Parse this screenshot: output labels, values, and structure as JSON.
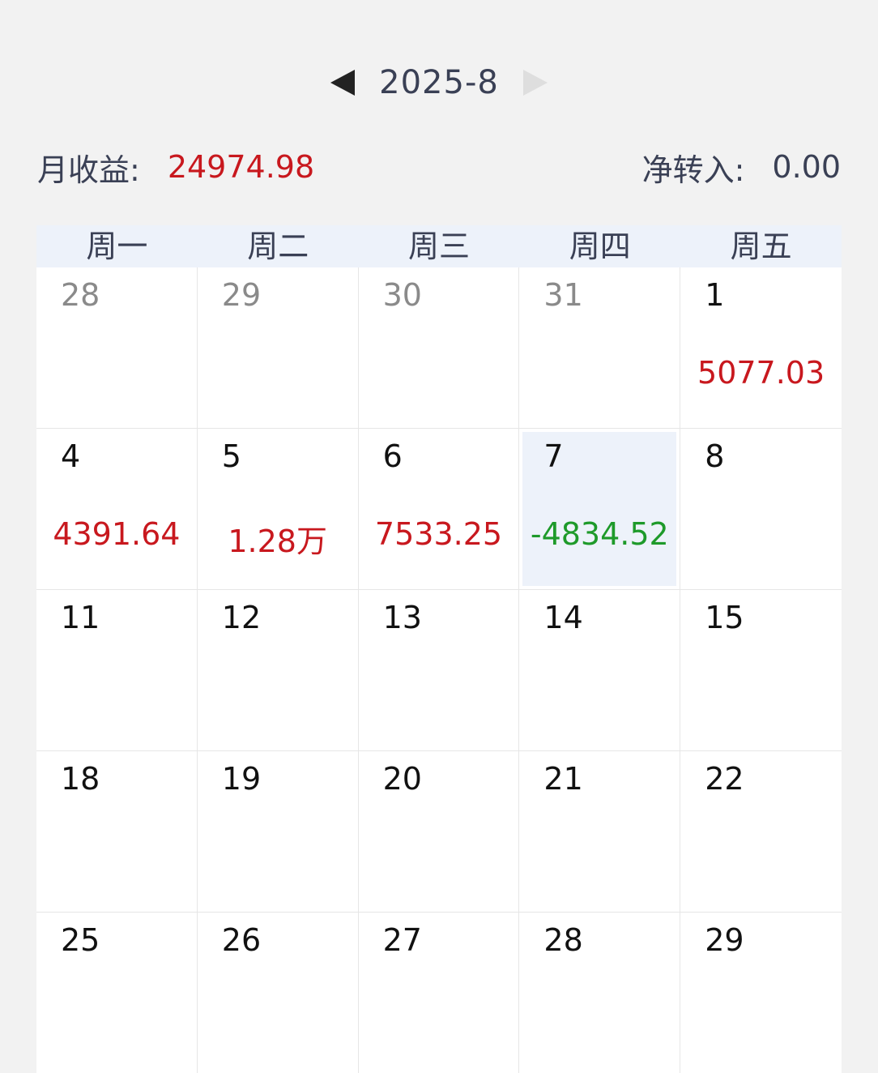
{
  "header": {
    "month_label": "2025-8",
    "prev_icon": "triangle-left-icon",
    "next_icon": "triangle-right-icon"
  },
  "summary": {
    "monthly_income_label": "月收益:",
    "monthly_income_value": "24974.98",
    "net_transfer_label": "净转入:",
    "net_transfer_value": "0.00"
  },
  "colors": {
    "positive": "#c8181e",
    "negative": "#1e9a2a",
    "header_bg": "#edf2fa"
  },
  "calendar": {
    "weekdays": [
      "周一",
      "周二",
      "周三",
      "周四",
      "周五"
    ],
    "weeks": [
      [
        {
          "day": "28",
          "amount": "",
          "other": true
        },
        {
          "day": "29",
          "amount": "",
          "other": true
        },
        {
          "day": "30",
          "amount": "",
          "other": true
        },
        {
          "day": "31",
          "amount": "",
          "other": true
        },
        {
          "day": "1",
          "amount": "5077.03",
          "sign": "pos"
        }
      ],
      [
        {
          "day": "4",
          "amount": "4391.64",
          "sign": "pos"
        },
        {
          "day": "5",
          "amount": "1.28万",
          "sign": "pos"
        },
        {
          "day": "6",
          "amount": "7533.25",
          "sign": "pos"
        },
        {
          "day": "7",
          "amount": "-4834.52",
          "sign": "neg",
          "selected": true
        },
        {
          "day": "8",
          "amount": ""
        }
      ],
      [
        {
          "day": "11",
          "amount": ""
        },
        {
          "day": "12",
          "amount": ""
        },
        {
          "day": "13",
          "amount": ""
        },
        {
          "day": "14",
          "amount": ""
        },
        {
          "day": "15",
          "amount": ""
        }
      ],
      [
        {
          "day": "18",
          "amount": ""
        },
        {
          "day": "19",
          "amount": ""
        },
        {
          "day": "20",
          "amount": ""
        },
        {
          "day": "21",
          "amount": ""
        },
        {
          "day": "22",
          "amount": ""
        }
      ],
      [
        {
          "day": "25",
          "amount": ""
        },
        {
          "day": "26",
          "amount": ""
        },
        {
          "day": "27",
          "amount": ""
        },
        {
          "day": "28",
          "amount": ""
        },
        {
          "day": "29",
          "amount": ""
        }
      ]
    ]
  }
}
